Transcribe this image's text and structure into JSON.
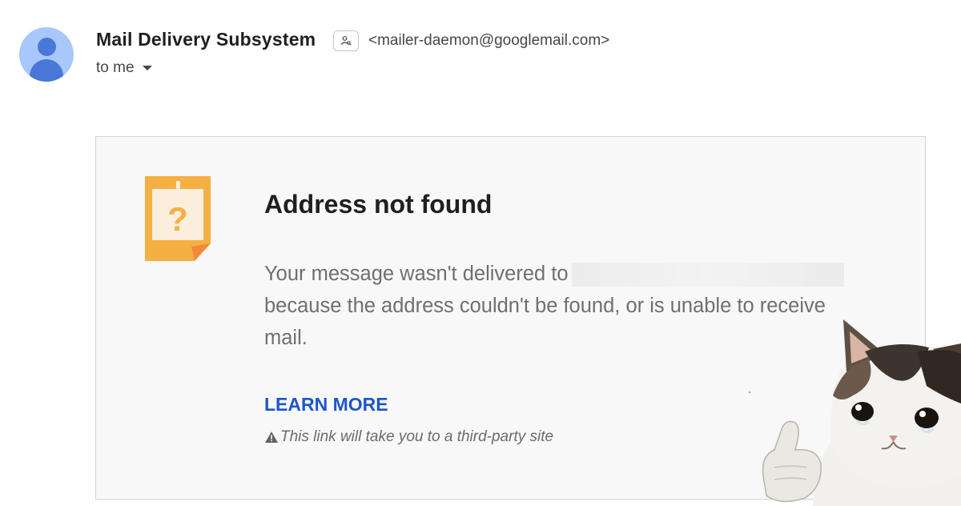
{
  "header": {
    "sender_name": "Mail Delivery Subsystem",
    "sender_email": "<mailer-daemon@googlemail.com>",
    "recipient": "to me",
    "avatar_icon": "person-icon",
    "contact_icon": "contact-card-icon"
  },
  "bounce": {
    "title": "Address not found",
    "message_prefix": "Your message wasn't delivered to",
    "message_suffix": "because the address couldn't be found, or is unable to receive mail.",
    "learn_more": "LEARN MORE",
    "warning_note": "This link will take you to a third-party site",
    "graphic_icon": "question-note-icon"
  },
  "colors": {
    "link": "#1f55c8",
    "note_orange": "#f4b042",
    "avatar_bg": "#a8c7fa",
    "avatar_fg": "#4a78d8"
  },
  "overlay": {
    "image": "crying-cat-thumbs-up-sticker"
  }
}
